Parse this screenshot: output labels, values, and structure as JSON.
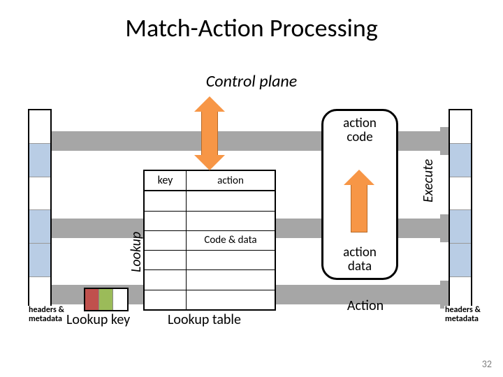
{
  "title": "Match-Action Processing",
  "control_plane": "Control plane",
  "left_stack_label": "headers &\nmetadata",
  "right_stack_label": "headers &\nmetadata",
  "lookup_key_caption": "Lookup key",
  "lookup_axis_label": "Lookup",
  "lookup_table": {
    "key_header": "key",
    "action_header": "action",
    "code_and_data": "Code & data",
    "caption": "Lookup table"
  },
  "action_box": {
    "code_label": "action\ncode",
    "data_label": "action\ndata"
  },
  "execute_axis_label": "Execute",
  "action_label": "Action",
  "page_number": "32",
  "colors": {
    "grey_arrow": "#a6a6a6",
    "orange": "#f79646",
    "red_cell": "#c0504d",
    "green_cell": "#9bbb59",
    "ltblue_cell": "#b9cde5"
  }
}
